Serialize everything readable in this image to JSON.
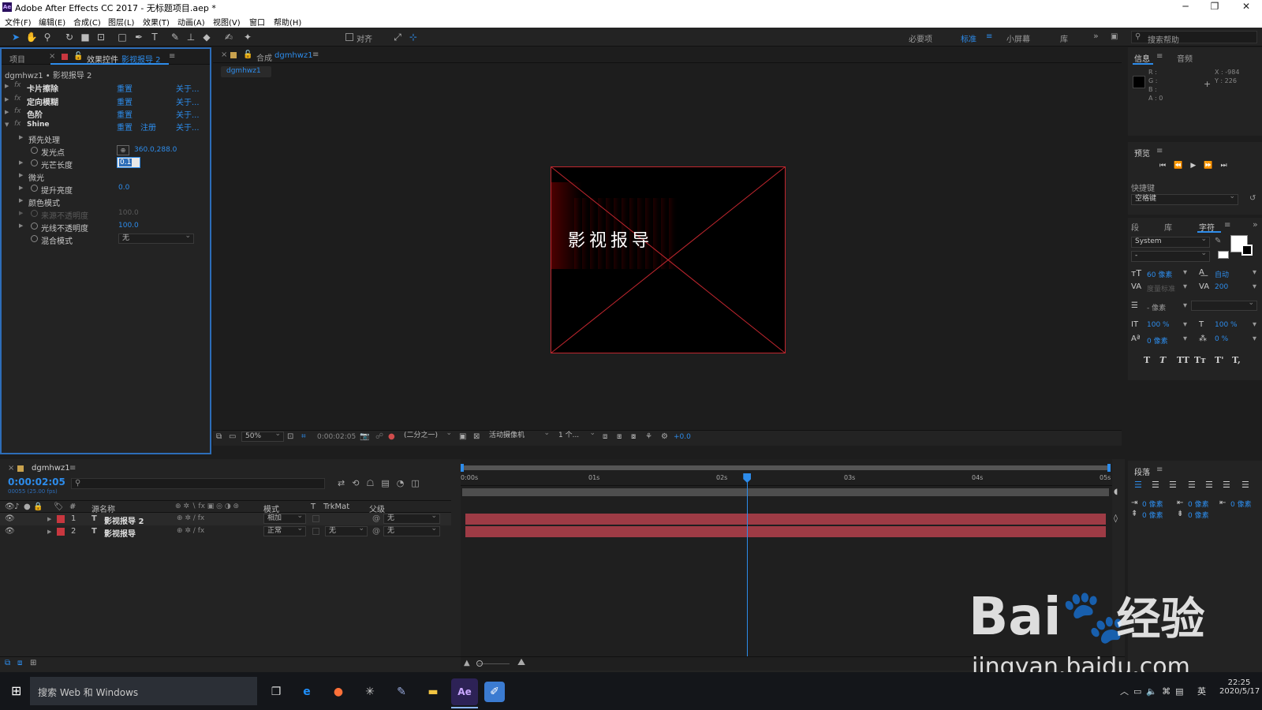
{
  "titlebar": {
    "title": "Adobe After Effects CC 2017 - 无标题项目.aep *",
    "minimize": "─",
    "restore": "❐",
    "close": "✕"
  },
  "menu": [
    "文件(F)",
    "编辑(E)",
    "合成(C)",
    "图层(L)",
    "效果(T)",
    "动画(A)",
    "视图(V)",
    "窗口",
    "帮助(H)"
  ],
  "toolbar": {
    "snap_label": "对齐",
    "workspaces": [
      "必要项",
      "标准",
      "小屏幕",
      "库"
    ],
    "active_workspace": "标准",
    "search_placeholder": "搜索帮助"
  },
  "effects_panel": {
    "tab_project": "项目",
    "tab_effects": "效果控件",
    "tab_effects_layer": "影视报导 2",
    "breadcrumb": "dgmhwz1 • 影视报导 2",
    "effects": [
      {
        "name": "卡片擦除",
        "reset": "重置",
        "about": "关于..."
      },
      {
        "name": "定向模糊",
        "reset": "重置",
        "about": "关于..."
      },
      {
        "name": "色阶",
        "reset": "重置",
        "about": "关于..."
      },
      {
        "name": "Shine",
        "reset": "重置",
        "register": "注册",
        "about": "关于..."
      }
    ],
    "props": {
      "preprocess": "预先处理",
      "source_point": "发光点",
      "source_point_value": "360.0,288.0",
      "ray_length": "光芒长度",
      "ray_length_value": "0.1",
      "shimmer": "微光",
      "boost_light": "提升亮度",
      "boost_light_value": "0.0",
      "colorize": "颜色模式",
      "source_opacity": "来源不透明度",
      "source_opacity_value": "100.0",
      "shine_opacity": "光线不透明度",
      "shine_opacity_value": "100.0",
      "transfer_mode": "混合模式",
      "transfer_mode_value": "无"
    }
  },
  "composition": {
    "tab_prefix": "合成",
    "tab_name": "dgmhwz1",
    "subtab": "dgmhwz1",
    "text": "影视报导",
    "footer": {
      "zoom": "50%",
      "timecode": "0:00:02:05",
      "resolution": "(二分之一)",
      "camera": "活动摄像机",
      "views": "1 个...",
      "exposure": "+0.0"
    }
  },
  "info_panel": {
    "tab_info": "信息",
    "tab_audio": "音频",
    "r": "R :",
    "g": "G :",
    "b": "B :",
    "a": "A : 0",
    "x": "X : -984",
    "y": "Y : 226"
  },
  "preview_panel": {
    "title": "预览",
    "shortcut_label": "快捷键",
    "shortcut_value": "空格键"
  },
  "character_panel": {
    "tab_a": "段",
    "tab_b": "库",
    "tab_c": "字符",
    "font": "System",
    "style": "-",
    "size": "60 像素",
    "leading": "自动",
    "kerning": "度量标准",
    "tracking": "200",
    "stroke": "- 像素",
    "vscale": "100 %",
    "hscale": "100 %",
    "baseline": "0 像素",
    "tsume": "0 %",
    "style_buttons": [
      "T",
      "T",
      "TT",
      "Tт",
      "T'",
      "T,"
    ]
  },
  "paragraph_panel": {
    "title": "段落",
    "indent_left": "0 像素",
    "indent_first": "0 像素",
    "indent_right": "0 像素",
    "space_before": "0 像素",
    "space_after": "0 像素"
  },
  "timeline": {
    "tab": "dgmhwz1",
    "timecode": "0:00:02:05",
    "frames": "00055 (25.00 fps)",
    "columns": {
      "num": "#",
      "source": "源名称",
      "mode": "模式",
      "t": "T",
      "trkmat": "TrkMat",
      "parent": "父级"
    },
    "ruler": [
      "0:00s",
      "01s",
      "02s",
      "03s",
      "04s",
      "05s"
    ],
    "playhead_fraction": 0.44,
    "layers": [
      {
        "num": "1",
        "type": "T",
        "name": "影视报导 2",
        "mode": "相加",
        "trkmat": "",
        "parent": "无"
      },
      {
        "num": "2",
        "type": "T",
        "name": "影视报导",
        "mode": "正常",
        "trkmat": "无",
        "parent": "无"
      }
    ]
  },
  "taskbar": {
    "search": "搜索 Web 和 Windows",
    "time": "22:25",
    "date": "2020/5/17",
    "ime": "英"
  },
  "watermark": {
    "brand": "Bai",
    "brand_cn": "经验",
    "url": "jingyan.baidu.com"
  },
  "colors": {
    "accent": "#2d8ceb",
    "layer_red": "#c8373f",
    "bar": "#9e3b45",
    "playhead": "#2d8ceb"
  }
}
